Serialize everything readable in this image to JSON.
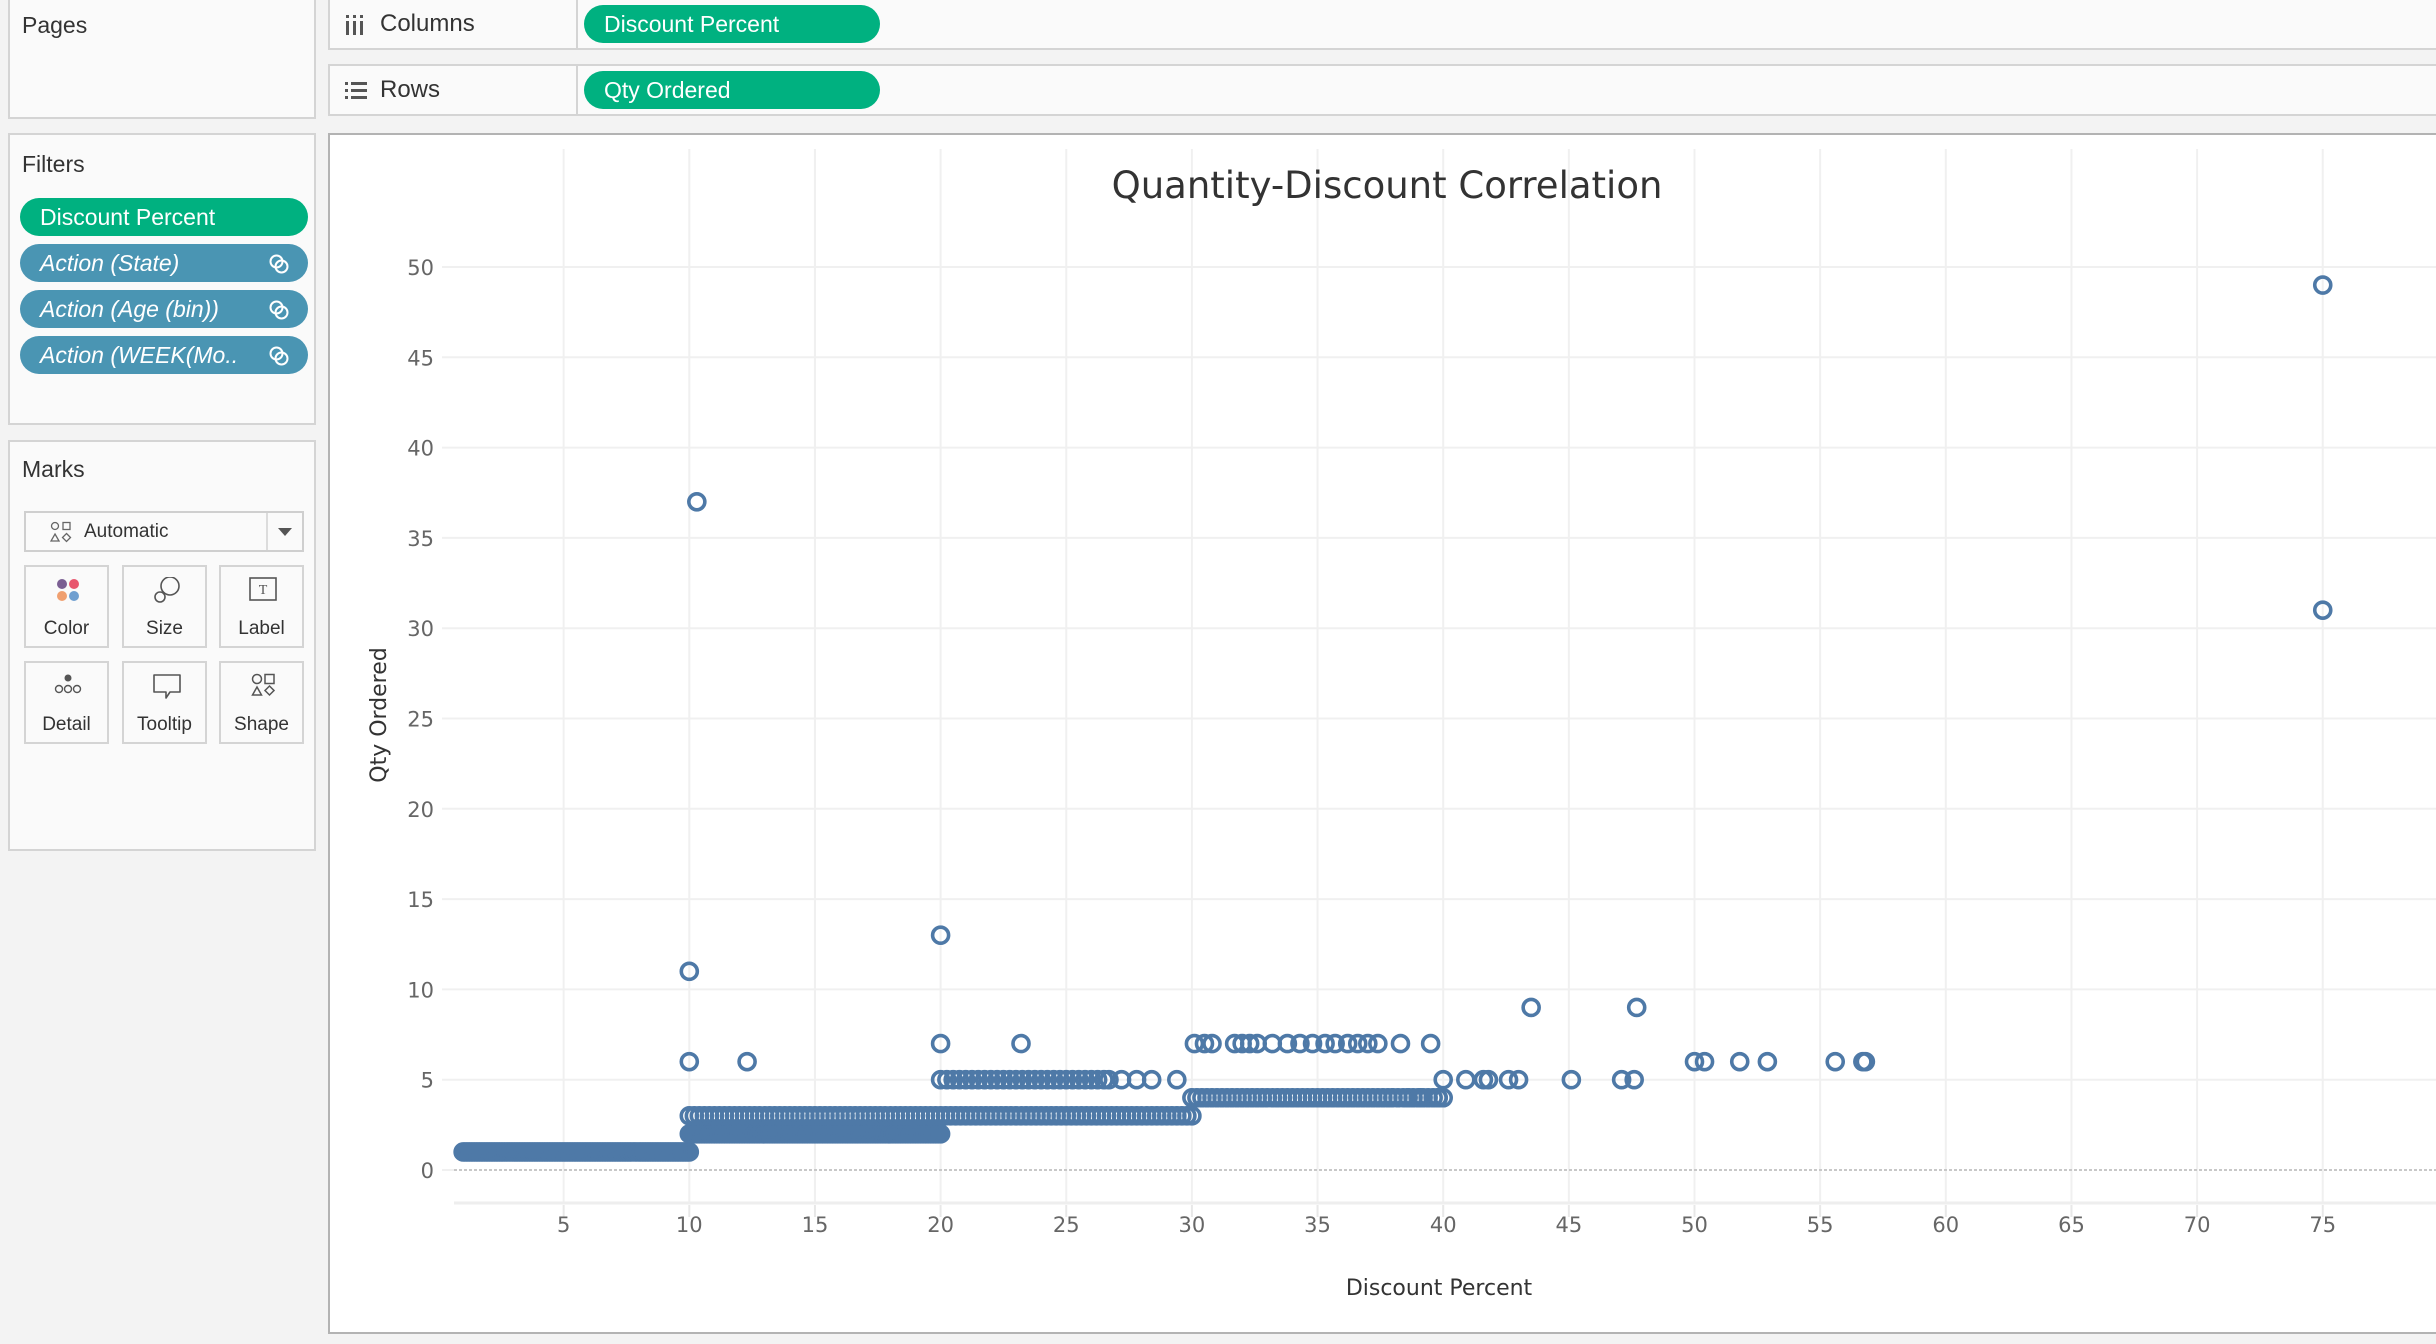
{
  "pages": {
    "title": "Pages"
  },
  "shelves": {
    "columns": {
      "label": "Columns",
      "icon": "columns-icon",
      "pill": "Discount Percent"
    },
    "rows": {
      "label": "Rows",
      "icon": "rows-icon",
      "pill": "Qty Ordered"
    }
  },
  "filters": {
    "title": "Filters",
    "items": [
      {
        "label": "Discount Percent",
        "type": "measure",
        "color": "#00b180"
      },
      {
        "label": "Action (State)",
        "type": "action",
        "color": "#4a95b3",
        "icon": "linked-rings-icon"
      },
      {
        "label": "Action (Age (bin))",
        "type": "action",
        "color": "#4a95b3",
        "icon": "linked-rings-icon"
      },
      {
        "label": "Action (WEEK(Mo..",
        "type": "action",
        "color": "#4a95b3",
        "icon": "linked-rings-icon"
      }
    ]
  },
  "marks": {
    "title": "Marks",
    "mark_type": "Automatic",
    "buttons": [
      {
        "label": "Color",
        "icon": "color-icon"
      },
      {
        "label": "Size",
        "icon": "size-icon"
      },
      {
        "label": "Label",
        "icon": "label-icon"
      },
      {
        "label": "Detail",
        "icon": "detail-icon"
      },
      {
        "label": "Tooltip",
        "icon": "tooltip-icon"
      },
      {
        "label": "Shape",
        "icon": "shape-icon"
      }
    ]
  },
  "colors": {
    "mark": "#4e79a7",
    "pill_green": "#00b180",
    "pill_blue": "#4a95b3",
    "gridline": "#f0f0f0",
    "zero_line": "#c8c8c8"
  },
  "chart_data": {
    "type": "scatter",
    "title": "Quantity-Discount Correlation",
    "xlabel": "Discount Percent",
    "ylabel": "Qty Ordered",
    "xlim": [
      0.5,
      79
    ],
    "ylim": [
      -2,
      52
    ],
    "xticks": [
      5,
      10,
      15,
      20,
      25,
      30,
      35,
      40,
      45,
      50,
      55,
      60,
      65,
      70,
      75
    ],
    "yticks": [
      0,
      5,
      10,
      15,
      20,
      25,
      30,
      35,
      40,
      45,
      50
    ],
    "grid": true,
    "mark_shape": "open-circle",
    "dense_runs": [
      {
        "y": 1,
        "x_from": 1,
        "x_to": 10,
        "step": 0.1
      },
      {
        "y": 2,
        "x_from": 10,
        "x_to": 20,
        "step": 0.1
      },
      {
        "y": 3,
        "x_from": 10,
        "x_to": 30,
        "step": 0.2
      },
      {
        "y": 4,
        "x_from": 30,
        "x_to": 40,
        "step": 0.2
      },
      {
        "y": 5,
        "x_from": 20,
        "x_to": 26.5,
        "step": 0.25
      }
    ],
    "points": [
      {
        "x": 10.3,
        "y": 37
      },
      {
        "x": 75,
        "y": 49
      },
      {
        "x": 75,
        "y": 31
      },
      {
        "x": 10,
        "y": 11
      },
      {
        "x": 20,
        "y": 13
      },
      {
        "x": 10,
        "y": 6
      },
      {
        "x": 12.3,
        "y": 6
      },
      {
        "x": 20,
        "y": 7
      },
      {
        "x": 23.2,
        "y": 7
      },
      {
        "x": 26.7,
        "y": 5
      },
      {
        "x": 27.2,
        "y": 5
      },
      {
        "x": 27.8,
        "y": 5
      },
      {
        "x": 28.4,
        "y": 5
      },
      {
        "x": 29.4,
        "y": 5
      },
      {
        "x": 30.1,
        "y": 7
      },
      {
        "x": 30.5,
        "y": 7
      },
      {
        "x": 30.8,
        "y": 7
      },
      {
        "x": 31.7,
        "y": 7
      },
      {
        "x": 32.0,
        "y": 7
      },
      {
        "x": 32.3,
        "y": 7
      },
      {
        "x": 32.6,
        "y": 7
      },
      {
        "x": 33.2,
        "y": 7
      },
      {
        "x": 33.8,
        "y": 7
      },
      {
        "x": 34.3,
        "y": 7
      },
      {
        "x": 34.8,
        "y": 7
      },
      {
        "x": 35.3,
        "y": 7
      },
      {
        "x": 35.7,
        "y": 7
      },
      {
        "x": 36.2,
        "y": 7
      },
      {
        "x": 36.6,
        "y": 7
      },
      {
        "x": 37.0,
        "y": 7
      },
      {
        "x": 37.4,
        "y": 7
      },
      {
        "x": 38.3,
        "y": 7
      },
      {
        "x": 39.5,
        "y": 7
      },
      {
        "x": 38.0,
        "y": 4
      },
      {
        "x": 38.6,
        "y": 4
      },
      {
        "x": 39.1,
        "y": 4
      },
      {
        "x": 39.8,
        "y": 4
      },
      {
        "x": 40.0,
        "y": 5
      },
      {
        "x": 40.9,
        "y": 5
      },
      {
        "x": 41.6,
        "y": 5
      },
      {
        "x": 41.8,
        "y": 5
      },
      {
        "x": 42.6,
        "y": 5
      },
      {
        "x": 43.0,
        "y": 5
      },
      {
        "x": 43.5,
        "y": 9
      },
      {
        "x": 45.1,
        "y": 5
      },
      {
        "x": 47.1,
        "y": 5
      },
      {
        "x": 47.6,
        "y": 5
      },
      {
        "x": 47.7,
        "y": 9
      },
      {
        "x": 50.0,
        "y": 6
      },
      {
        "x": 50.4,
        "y": 6
      },
      {
        "x": 51.8,
        "y": 6
      },
      {
        "x": 52.9,
        "y": 6
      },
      {
        "x": 55.6,
        "y": 6
      },
      {
        "x": 56.7,
        "y": 6
      },
      {
        "x": 56.8,
        "y": 6
      }
    ]
  }
}
